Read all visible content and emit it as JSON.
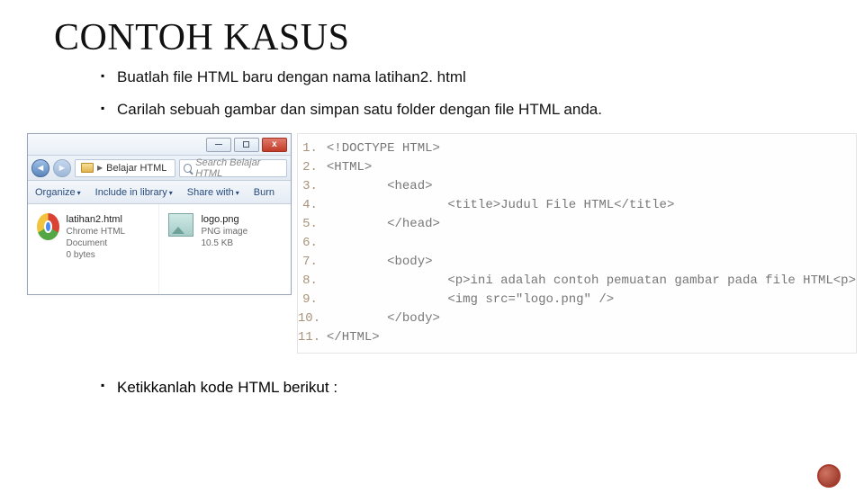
{
  "title": "CONTOH KASUS",
  "bullets": {
    "b1": "Buatlah file HTML baru dengan nama latihan2. html",
    "b2": "Carilah sebuah gambar dan simpan satu folder dengan file HTML anda.",
    "b3": "Ketikkanlah kode HTML berikut :"
  },
  "explorer": {
    "folder": "Belajar HTML",
    "chevron": "▶",
    "search_placeholder": "Search Belajar HTML",
    "toolbar": {
      "organize": "Organize",
      "include": "Include in library",
      "share": "Share with",
      "burn": "Burn"
    },
    "files": [
      {
        "name": "latihan2.html",
        "type": "Chrome HTML Document",
        "size": "0 bytes"
      },
      {
        "name": "logo.png",
        "type": "PNG image",
        "size": "10.5 KB"
      }
    ],
    "winbuttons": {
      "close": "x"
    }
  },
  "code": {
    "lines": [
      {
        "n": "1.",
        "indent": 0,
        "text": "<!DOCTYPE HTML>"
      },
      {
        "n": "2.",
        "indent": 0,
        "text": "<HTML>"
      },
      {
        "n": "3.",
        "indent": 2,
        "text": "<head>"
      },
      {
        "n": "4.",
        "indent": 4,
        "text": "<title>Judul File HTML</title>"
      },
      {
        "n": "5.",
        "indent": 2,
        "text": "</head>"
      },
      {
        "n": "6.",
        "indent": 0,
        "text": ""
      },
      {
        "n": "7.",
        "indent": 2,
        "text": "<body>"
      },
      {
        "n": "8.",
        "indent": 4,
        "text": "<p>ini adalah contoh pemuatan gambar pada file HTML<p>"
      },
      {
        "n": "9.",
        "indent": 4,
        "text": "<img src=\"logo.png\" />"
      },
      {
        "n": "10.",
        "indent": 2,
        "text": "</body>"
      },
      {
        "n": "11.",
        "indent": 0,
        "text": "</HTML>"
      }
    ]
  }
}
